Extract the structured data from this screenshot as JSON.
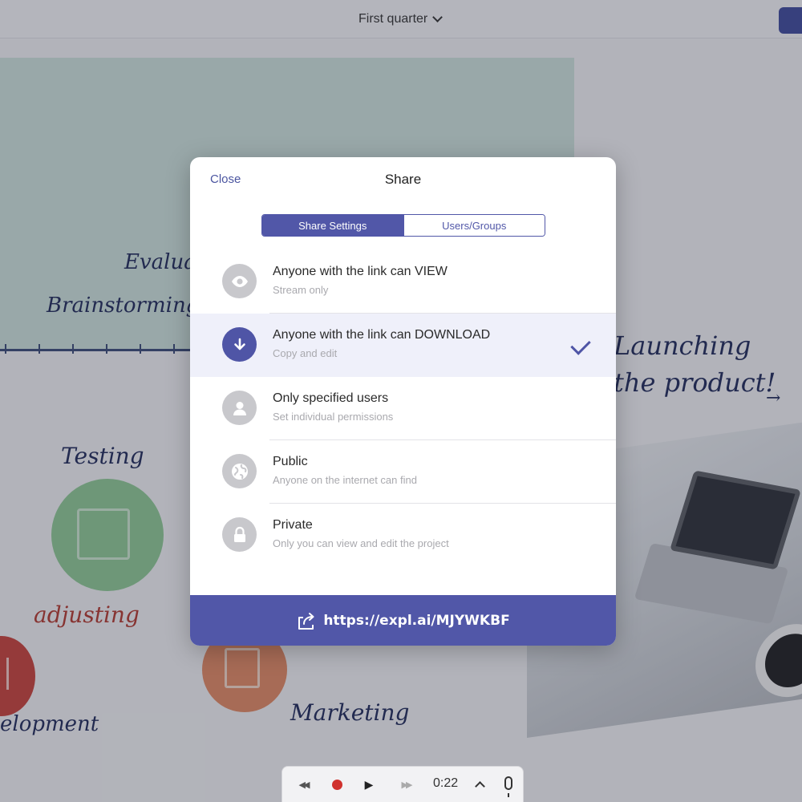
{
  "topbar": {
    "doc_title": "First quarter"
  },
  "canvas": {
    "handwriting": {
      "evaluation": "Evaluati",
      "brainstorming": "Brainstorming",
      "testing": "Testing",
      "adjusting": "adjusting",
      "development": "elopment",
      "marketing": "Marketing",
      "launching": "Launching",
      "the_product": "the product!",
      "arrow": "→"
    }
  },
  "modal": {
    "close_label": "Close",
    "title": "Share",
    "tabs": [
      {
        "label": "Share Settings",
        "active": true
      },
      {
        "label": "Users/Groups",
        "active": false
      }
    ],
    "options": [
      {
        "label": "Anyone with the link can VIEW",
        "sublabel": "Stream only",
        "icon": "eye-icon",
        "selected": false
      },
      {
        "label": "Anyone with the link can DOWNLOAD",
        "sublabel": "Copy and edit",
        "icon": "download-icon",
        "selected": true
      },
      {
        "label": "Only specified users",
        "sublabel": "Set individual permissions",
        "icon": "user-icon",
        "selected": false
      },
      {
        "label": "Public",
        "sublabel": "Anyone on the internet can find",
        "icon": "globe-icon",
        "selected": false
      },
      {
        "label": "Private",
        "sublabel": "Only you can view and edit the project",
        "icon": "lock-icon",
        "selected": false
      }
    ],
    "share_link": "https://expl.ai/MJYWKBF"
  },
  "transport": {
    "time": "0:22",
    "rewind_glyph": "◀◀",
    "play_glyph": "▶",
    "forward_glyph": "▶▶"
  }
}
